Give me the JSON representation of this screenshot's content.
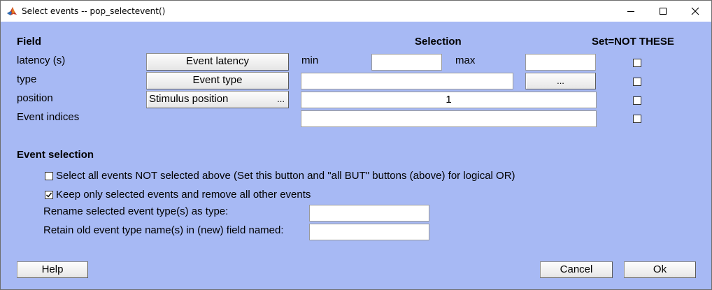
{
  "window": {
    "title": "Select events -- pop_selectevent()",
    "icon": "matlab-logo-icon"
  },
  "colors": {
    "background": "#a7b9f4",
    "titlebar": "#ffffff"
  },
  "header": {
    "field": "Field",
    "selection": "Selection",
    "not_these": "Set=NOT THESE"
  },
  "rows": {
    "latency": {
      "label": "latency (s)",
      "button": "Event latency",
      "min_label": "min",
      "max_label": "max",
      "min_value": "",
      "max_value": "",
      "not_checked": false
    },
    "type": {
      "label": "type",
      "button": "Event type",
      "value": "",
      "browse_button": "...",
      "not_checked": false
    },
    "position": {
      "label": "position",
      "button": "Stimulus position",
      "button_suffix": "...",
      "value": "1",
      "not_checked": false
    },
    "indices": {
      "label": "Event indices",
      "value": "",
      "not_checked": false
    }
  },
  "event_selection": {
    "heading": "Event selection",
    "option_not_selected": {
      "label": "Select all events NOT selected above (Set this button and \"all BUT\" buttons (above) for logical OR)",
      "checked": false
    },
    "option_keep_only": {
      "label": "Keep only selected events and remove all other events",
      "checked": true
    },
    "rename_label": "Rename selected event type(s) as type:",
    "rename_value": "",
    "retain_label": "Retain old event type name(s) in (new) field named:",
    "retain_value": ""
  },
  "footer": {
    "help": "Help",
    "cancel": "Cancel",
    "ok": "Ok"
  }
}
